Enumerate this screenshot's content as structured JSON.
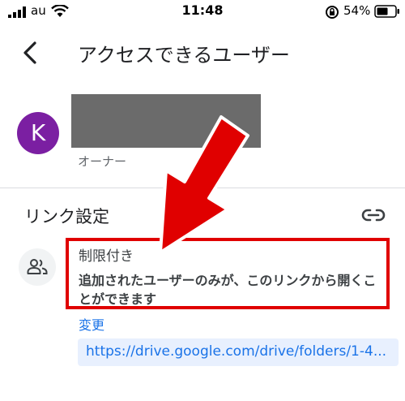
{
  "status_bar": {
    "carrier": "au",
    "time": "11:48",
    "battery_percent": "54%"
  },
  "header": {
    "title": "アクセスできるユーザー"
  },
  "owner": {
    "avatar_initial": "K",
    "avatar_color": "#7b1fa2",
    "role": "オーナー"
  },
  "link_settings": {
    "section_title": "リンク設定",
    "access_level": "制限付き",
    "description": "追加されたユーザーのみが、このリンクから開くことができます",
    "change_label": "変更",
    "url": "https://drive.google.com/drive/folders/1-4..."
  },
  "colors": {
    "accent": "#1a73e8",
    "annotation_red": "#e00000"
  },
  "icons": [
    "signal-icon",
    "wifi-icon",
    "rotation-lock-icon",
    "battery-icon",
    "back-arrow-icon",
    "link-icon",
    "people-icon",
    "annotation-arrow"
  ]
}
